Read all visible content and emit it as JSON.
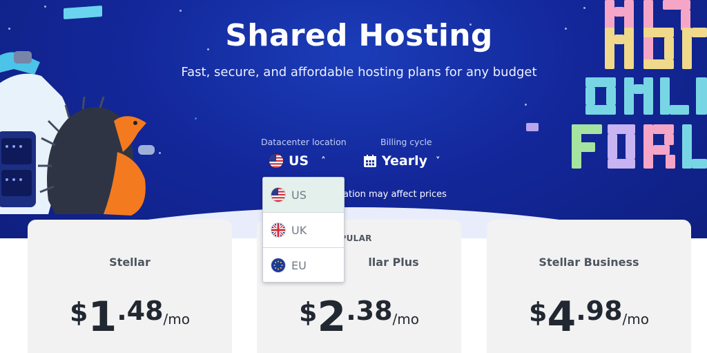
{
  "hero": {
    "title": "Shared Hosting",
    "subtitle": "Fast, secure, and affordable hosting plans for any budget"
  },
  "datacenter": {
    "label": "Datacenter location",
    "selected": "US",
    "note": "ation may affect prices",
    "options": [
      {
        "label": "US",
        "flag": "us-flag-icon",
        "selected": true
      },
      {
        "label": "UK",
        "flag": "uk-flag-icon",
        "selected": false
      },
      {
        "label": "EU",
        "flag": "eu-flag-icon",
        "selected": false
      }
    ]
  },
  "billing": {
    "label": "Billing cycle",
    "selected": "Yearly",
    "icon": "calendar-icon"
  },
  "plans": [
    {
      "name": "Stellar",
      "currency": "$",
      "int": "1",
      "dec": ".48",
      "per": "/mo"
    },
    {
      "name": "llar Plus",
      "badge": "OPULAR",
      "currency": "$",
      "int": "2",
      "dec": ".38",
      "per": "/mo"
    },
    {
      "name": "Stellar Business",
      "currency": "$",
      "int": "4",
      "dec": ".98",
      "per": "/mo"
    }
  ],
  "colors": {
    "hero_bg": "#13279a",
    "card_bg": "#f2f2f2",
    "dropdown_selected_bg": "#e3f0ec",
    "text_dark": "#222831"
  }
}
